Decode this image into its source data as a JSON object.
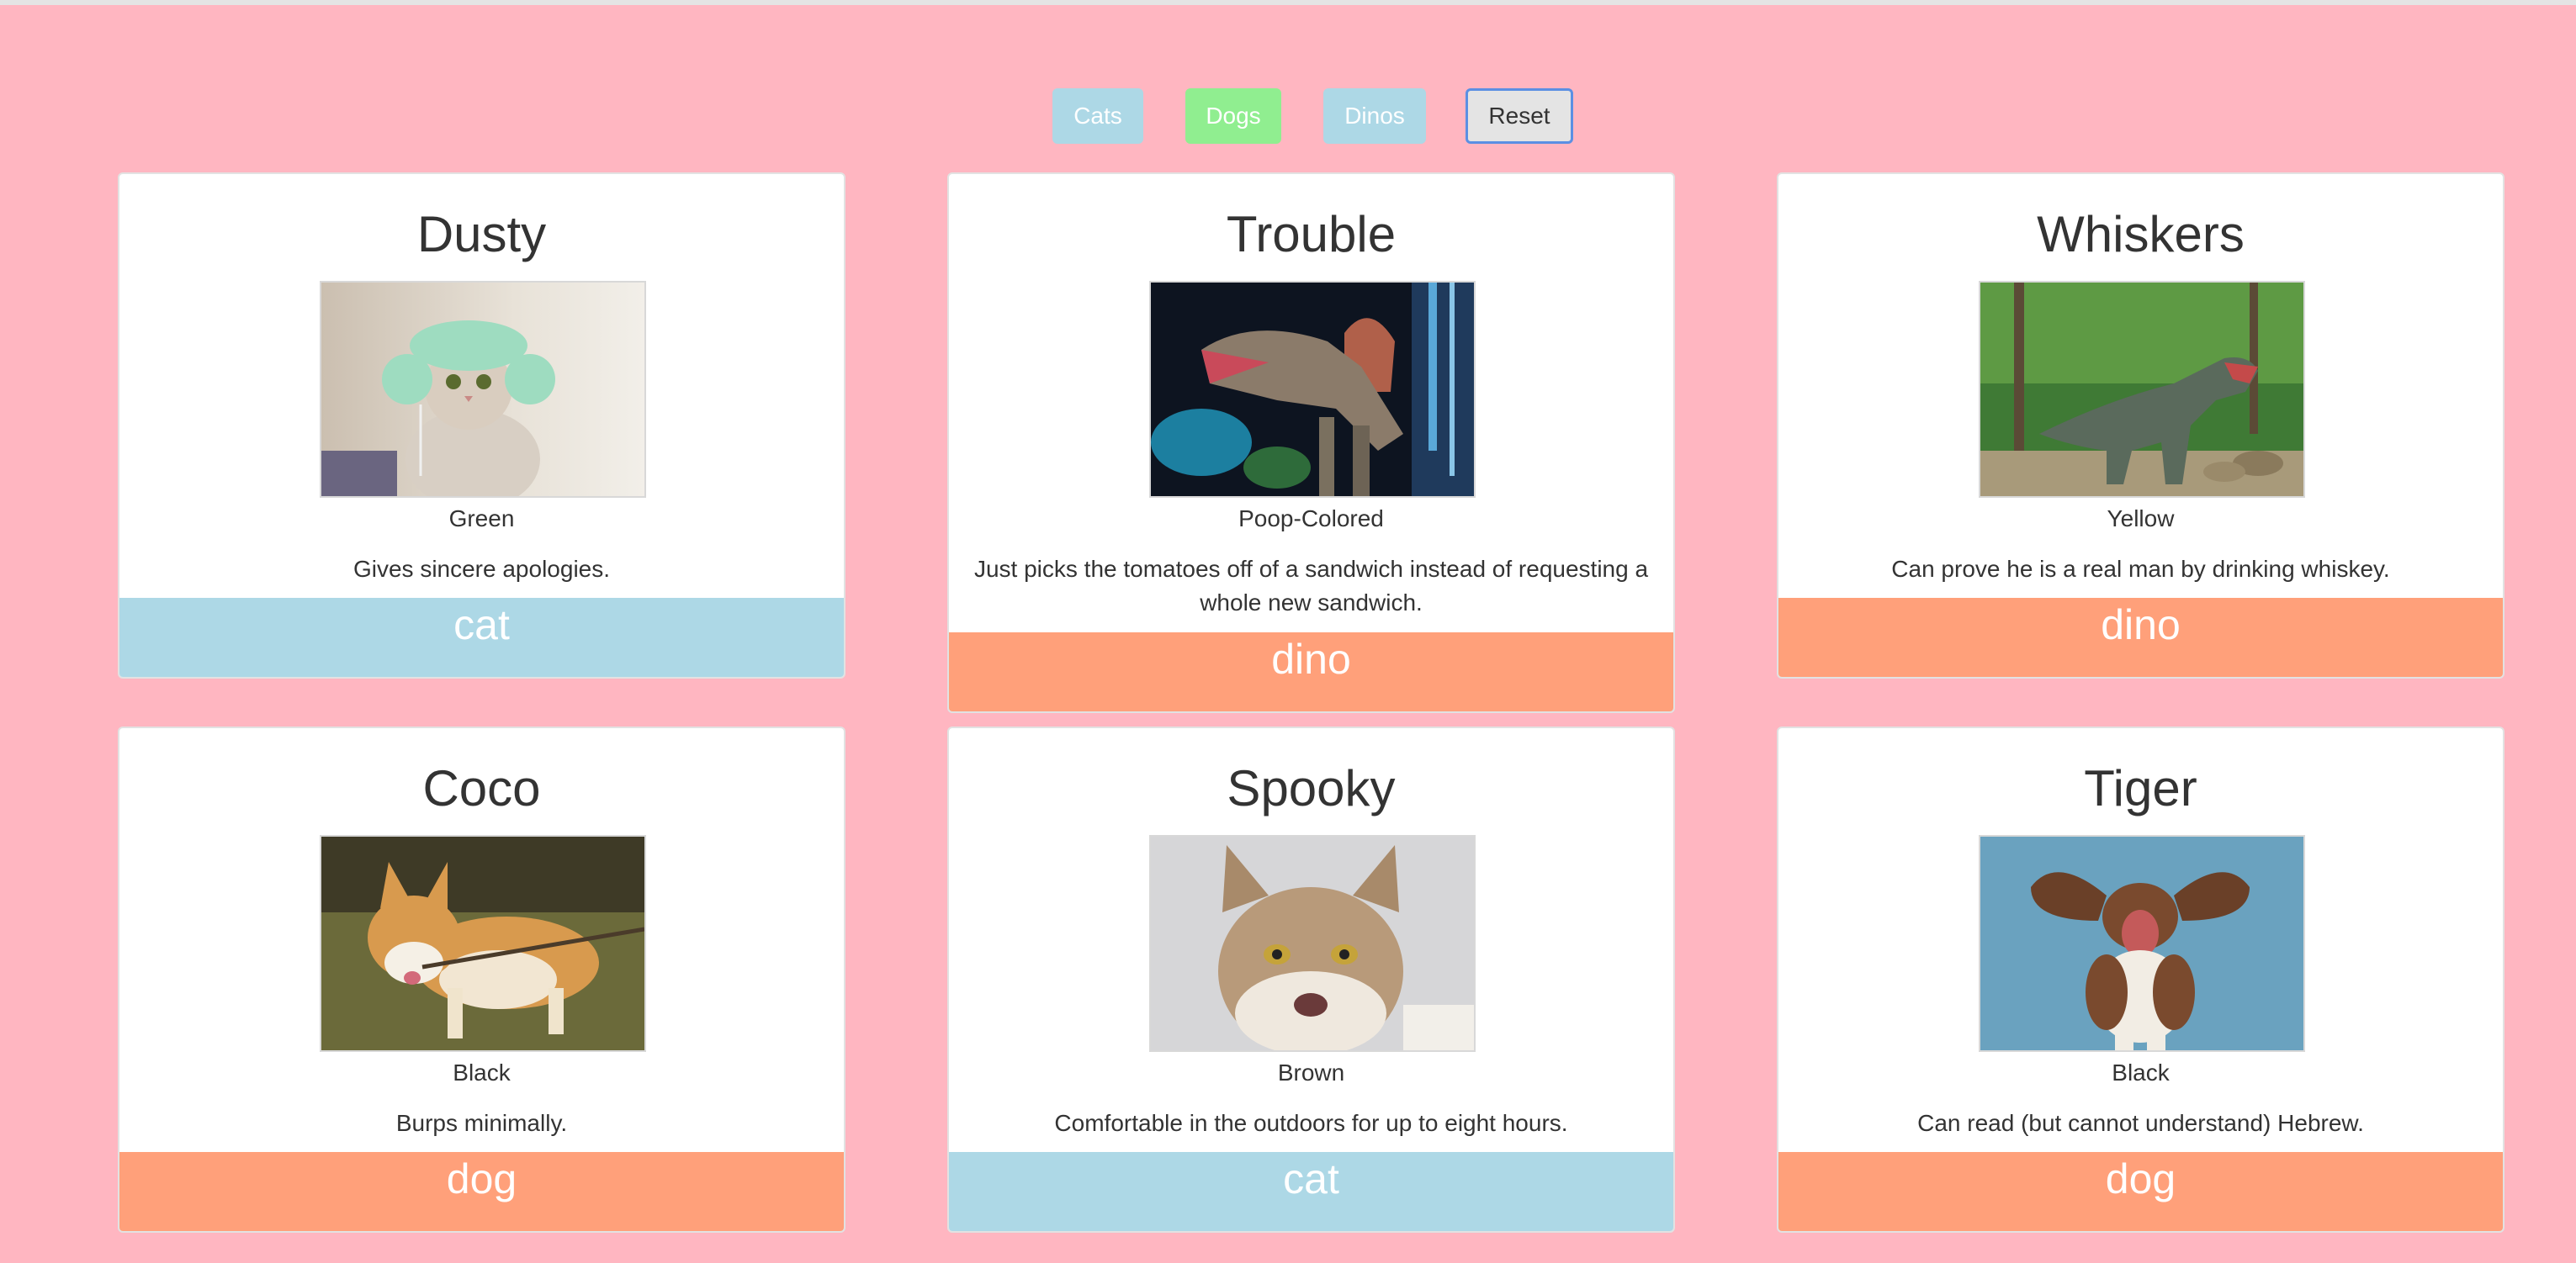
{
  "filters": {
    "cats_label": "Cats",
    "dogs_label": "Dogs",
    "dinos_label": "Dinos",
    "reset_label": "Reset"
  },
  "colors": {
    "page_background": "#ffb6c1",
    "cat_tag": "#add8e6",
    "dog_dino_tag": "#ffa07a",
    "cats_button": "#add8e6",
    "dogs_button": "#90ee90",
    "dinos_button": "#add8e6"
  },
  "pets": [
    {
      "name": "Dusty",
      "color": "Green",
      "description": "Gives sincere apologies.",
      "type": "cat",
      "image": "cat-with-knit-hat"
    },
    {
      "name": "Trouble",
      "color": "Poop-Colored",
      "description": "Just picks the tomatoes off of a sandwich instead of requesting a whole new sandwich.",
      "type": "dino",
      "image": "spinosaurus-model"
    },
    {
      "name": "Whiskers",
      "color": "Yellow",
      "description": "Can prove he is a real man by drinking whiskey.",
      "type": "dino",
      "image": "t-rex-statue-forest"
    },
    {
      "name": "Coco",
      "color": "Black",
      "description": "Burps minimally.",
      "type": "dog",
      "image": "corgi-with-stick"
    },
    {
      "name": "Spooky",
      "color": "Brown",
      "description": "Comfortable in the outdoors for up to eight hours.",
      "type": "cat",
      "image": "maine-coon-cat"
    },
    {
      "name": "Tiger",
      "color": "Black",
      "description": "Can read (but cannot understand) Hebrew.",
      "type": "dog",
      "image": "basset-hound-flying-ears"
    }
  ]
}
